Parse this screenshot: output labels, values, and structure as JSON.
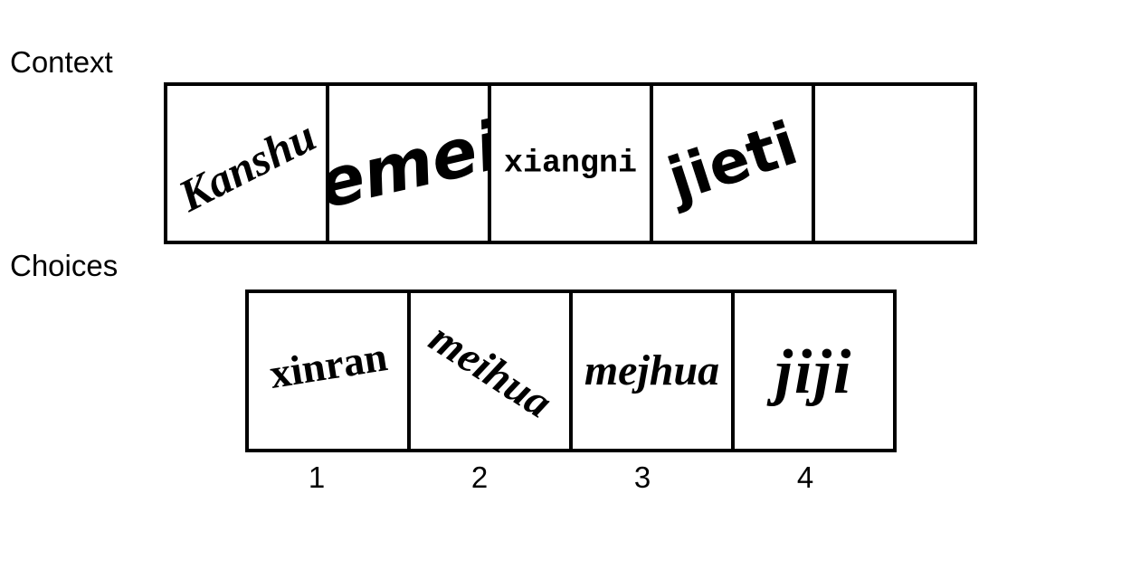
{
  "context": {
    "label": "Context",
    "items": [
      "Kanshu",
      "emei",
      "xiangni",
      "jieti",
      ""
    ]
  },
  "choices": {
    "label": "Choices",
    "items": [
      {
        "number": "1",
        "word": "xinran"
      },
      {
        "number": "2",
        "word": "meihua"
      },
      {
        "number": "3",
        "word": "mejhua"
      },
      {
        "number": "4",
        "word": "jiji"
      }
    ]
  }
}
